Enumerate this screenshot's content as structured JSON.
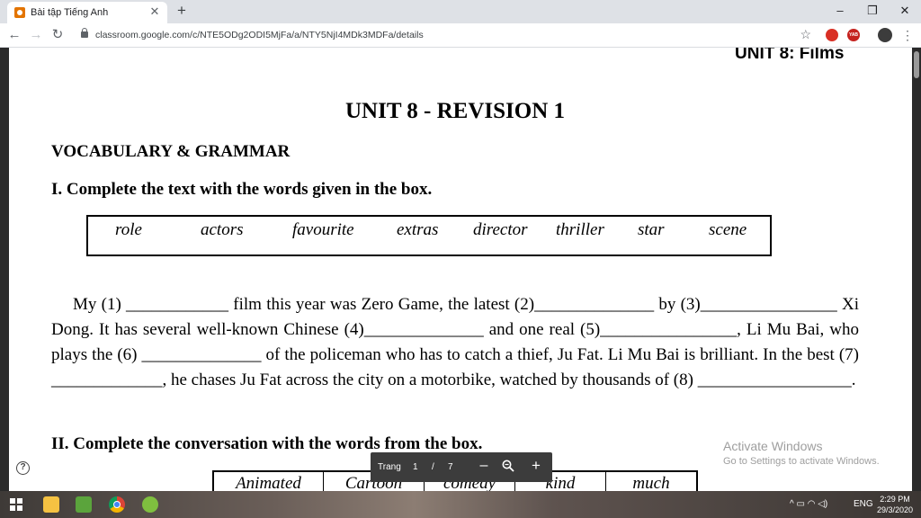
{
  "browser": {
    "tab_title": "Bài tập Tiếng Anh",
    "tab_close": "✕",
    "new_tab": "+",
    "url": "classroom.google.com/c/NTE5ODg2ODI5MjFa/a/NTY5NjI4MDk3MDFa/details",
    "window_controls": {
      "minimize": "–",
      "restore": "❐",
      "close": "✕"
    },
    "nav": {
      "back": "←",
      "forward": "→",
      "reload": "↻"
    },
    "bookmark_star": "☆",
    "ext2_label": "YAB",
    "menu": "⋮"
  },
  "document": {
    "unit_header": "UNIT 8: Films",
    "title": "UNIT 8 - REVISION 1",
    "section_vocab": "VOCABULARY & GRAMMAR",
    "section_1": "I. Complete the text with the words given in the box.",
    "word_box": [
      "role",
      "actors",
      "favourite",
      "extras",
      "director",
      "thriller",
      "star",
      "scene"
    ],
    "paragraph": "My (1) ____________ film this year was Zero Game, the latest (2)______________ by (3)________________ Xi Dong. It has several well-known Chinese (4)______________ and one real (5)________________, Li Mu Bai, who plays the (6) ______________ of the policeman who has to catch a thief, Ju Fat. Li Mu Bai is brilliant. In the best (7) _____________, he chases Ju Fat across the city on a motorbike, watched by thousands of (8) __________________.",
    "section_2": "II. Complete the conversation with the words from the box.",
    "table_2": [
      "Animated",
      "Cartoon",
      "comedy",
      "kind",
      "much"
    ]
  },
  "pdf_toolbar": {
    "page_label": "Trang",
    "current_page": "1",
    "separator": "/",
    "total_pages": "7",
    "zoom_out": "–",
    "zoom_in": "+"
  },
  "help": "?",
  "watermark": {
    "line1": "Activate Windows",
    "line2": "Go to Settings to activate Windows."
  },
  "taskbar": {
    "tray_lang": "ENG",
    "tray_icons": "^  ▭  ◠  ◁)",
    "time": "2:29 PM",
    "date": "29/3/2020"
  },
  "colors": {
    "tab_bar": "#dee1e6",
    "pdf_toolbar": "#3c3c3c",
    "rail": "#2a2a2a",
    "watermark": "#9e9e9e"
  }
}
